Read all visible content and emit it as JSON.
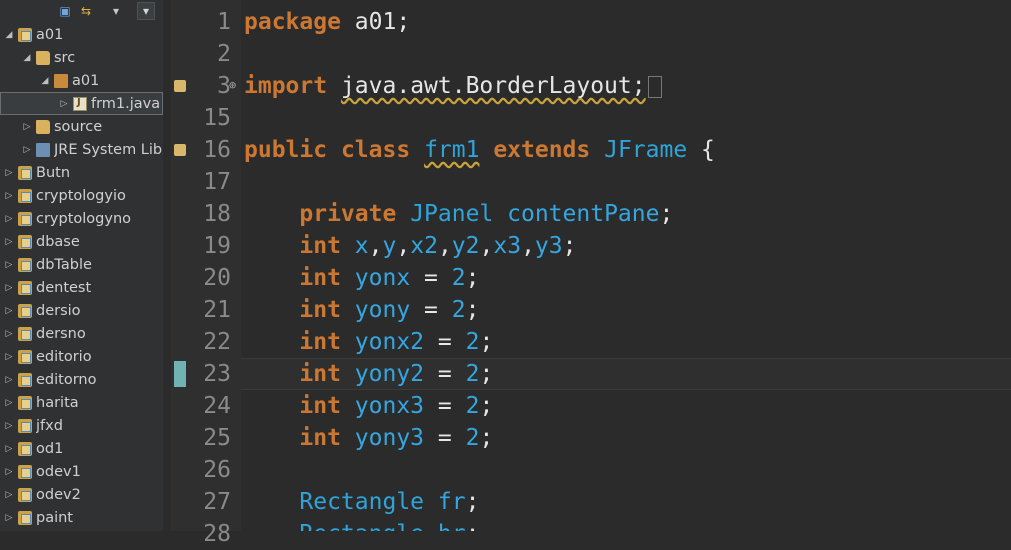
{
  "explorer": {
    "toolbar": {
      "collapse_icon": "collapse-all-icon",
      "link_icon": "link-with-editor-icon",
      "filter_icon": "filter-icon",
      "menu_icon": "view-menu-icon"
    },
    "items": [
      {
        "label": "a01",
        "twisty": "◢",
        "icon": "project",
        "indent": 0
      },
      {
        "label": "src",
        "twisty": "◢",
        "icon": "srcfolder",
        "indent": 1
      },
      {
        "label": "a01",
        "twisty": "◢",
        "icon": "package",
        "indent": 2
      },
      {
        "label": "frm1.java",
        "twisty": "▷",
        "icon": "java",
        "indent": 3,
        "selected": true
      },
      {
        "label": "source",
        "twisty": "▷",
        "icon": "srcfolder",
        "indent": 1
      },
      {
        "label": "JRE System Libr",
        "twisty": "▷",
        "icon": "lib",
        "indent": 1
      },
      {
        "label": "Butn",
        "twisty": "▷",
        "icon": "project",
        "indent": 0
      },
      {
        "label": "cryptologyio",
        "twisty": "▷",
        "icon": "project",
        "indent": 0
      },
      {
        "label": "cryptologyno",
        "twisty": "▷",
        "icon": "project",
        "indent": 0
      },
      {
        "label": "dbase",
        "twisty": "▷",
        "icon": "project",
        "indent": 0
      },
      {
        "label": "dbTable",
        "twisty": "▷",
        "icon": "project",
        "indent": 0
      },
      {
        "label": "dentest",
        "twisty": "▷",
        "icon": "project",
        "indent": 0
      },
      {
        "label": "dersio",
        "twisty": "▷",
        "icon": "project",
        "indent": 0
      },
      {
        "label": "dersno",
        "twisty": "▷",
        "icon": "project",
        "indent": 0
      },
      {
        "label": "editorio",
        "twisty": "▷",
        "icon": "project",
        "indent": 0
      },
      {
        "label": "editorno",
        "twisty": "▷",
        "icon": "project",
        "indent": 0
      },
      {
        "label": "harita",
        "twisty": "▷",
        "icon": "project",
        "indent": 0
      },
      {
        "label": "jfxd",
        "twisty": "▷",
        "icon": "project",
        "indent": 0
      },
      {
        "label": "od1",
        "twisty": "▷",
        "icon": "project",
        "indent": 0
      },
      {
        "label": "odev1",
        "twisty": "▷",
        "icon": "project",
        "indent": 0
      },
      {
        "label": "odev2",
        "twisty": "▷",
        "icon": "project",
        "indent": 0
      },
      {
        "label": "paint",
        "twisty": "▷",
        "icon": "project",
        "indent": 0
      }
    ]
  },
  "editor": {
    "line_numbers": [
      "1",
      "2",
      "3",
      "15",
      "16",
      "17",
      "18",
      "19",
      "20",
      "21",
      "22",
      "23",
      "24",
      "25",
      "26",
      "27",
      "28"
    ],
    "current_line_index": 11,
    "lines": [
      [
        {
          "t": "package",
          "c": "kw"
        },
        {
          "t": " a01;",
          "c": "pl"
        }
      ],
      [],
      [
        {
          "t": "import",
          "c": "kw"
        },
        {
          "t": " ",
          "c": "pl"
        },
        {
          "t": "java.awt.BorderLayout;",
          "c": "pl",
          "u": true
        }
      ],
      [],
      [
        {
          "t": "public",
          "c": "kw"
        },
        {
          "t": " ",
          "c": "pl"
        },
        {
          "t": "class",
          "c": "kw"
        },
        {
          "t": " ",
          "c": "pl"
        },
        {
          "t": "frm1",
          "c": "ty",
          "u": true
        },
        {
          "t": " ",
          "c": "pl"
        },
        {
          "t": "extends",
          "c": "kw"
        },
        {
          "t": " ",
          "c": "pl"
        },
        {
          "t": "JFrame",
          "c": "ty"
        },
        {
          "t": " {",
          "c": "pl"
        }
      ],
      [],
      [
        {
          "t": "    ",
          "c": "pl"
        },
        {
          "t": "private",
          "c": "kw"
        },
        {
          "t": " ",
          "c": "pl"
        },
        {
          "t": "JPanel",
          "c": "ty"
        },
        {
          "t": " ",
          "c": "pl"
        },
        {
          "t": "contentPane",
          "c": "fld"
        },
        {
          "t": ";",
          "c": "pl"
        }
      ],
      [
        {
          "t": "    ",
          "c": "pl"
        },
        {
          "t": "int",
          "c": "kw"
        },
        {
          "t": " ",
          "c": "pl"
        },
        {
          "t": "x",
          "c": "fld"
        },
        {
          "t": ",",
          "c": "pl"
        },
        {
          "t": "y",
          "c": "fld"
        },
        {
          "t": ",",
          "c": "pl"
        },
        {
          "t": "x2",
          "c": "fld"
        },
        {
          "t": ",",
          "c": "pl"
        },
        {
          "t": "y2",
          "c": "fld"
        },
        {
          "t": ",",
          "c": "pl"
        },
        {
          "t": "x3",
          "c": "fld"
        },
        {
          "t": ",",
          "c": "pl"
        },
        {
          "t": "y3",
          "c": "fld"
        },
        {
          "t": ";",
          "c": "pl"
        }
      ],
      [
        {
          "t": "    ",
          "c": "pl"
        },
        {
          "t": "int",
          "c": "kw"
        },
        {
          "t": " ",
          "c": "pl"
        },
        {
          "t": "yonx",
          "c": "fld"
        },
        {
          "t": " = ",
          "c": "pl"
        },
        {
          "t": "2",
          "c": "num"
        },
        {
          "t": ";",
          "c": "pl"
        }
      ],
      [
        {
          "t": "    ",
          "c": "pl"
        },
        {
          "t": "int",
          "c": "kw"
        },
        {
          "t": " ",
          "c": "pl"
        },
        {
          "t": "yony",
          "c": "fld"
        },
        {
          "t": " = ",
          "c": "pl"
        },
        {
          "t": "2",
          "c": "num"
        },
        {
          "t": ";",
          "c": "pl"
        }
      ],
      [
        {
          "t": "    ",
          "c": "pl"
        },
        {
          "t": "int",
          "c": "kw"
        },
        {
          "t": " ",
          "c": "pl"
        },
        {
          "t": "yonx2",
          "c": "fld"
        },
        {
          "t": " = ",
          "c": "pl"
        },
        {
          "t": "2",
          "c": "num"
        },
        {
          "t": ";",
          "c": "pl"
        }
      ],
      [
        {
          "t": "    ",
          "c": "pl"
        },
        {
          "t": "int",
          "c": "kw"
        },
        {
          "t": " ",
          "c": "pl"
        },
        {
          "t": "yony2",
          "c": "fld"
        },
        {
          "t": " = ",
          "c": "pl"
        },
        {
          "t": "2",
          "c": "num"
        },
        {
          "t": ";",
          "c": "pl"
        }
      ],
      [
        {
          "t": "    ",
          "c": "pl"
        },
        {
          "t": "int",
          "c": "kw"
        },
        {
          "t": " ",
          "c": "pl"
        },
        {
          "t": "yonx3",
          "c": "fld"
        },
        {
          "t": " = ",
          "c": "pl"
        },
        {
          "t": "2",
          "c": "num"
        },
        {
          "t": ";",
          "c": "pl"
        }
      ],
      [
        {
          "t": "    ",
          "c": "pl"
        },
        {
          "t": "int",
          "c": "kw"
        },
        {
          "t": " ",
          "c": "pl"
        },
        {
          "t": "yony3",
          "c": "fld"
        },
        {
          "t": " = ",
          "c": "pl"
        },
        {
          "t": "2",
          "c": "num"
        },
        {
          "t": ";",
          "c": "pl"
        }
      ],
      [],
      [
        {
          "t": "    ",
          "c": "pl"
        },
        {
          "t": "Rectangle",
          "c": "ty"
        },
        {
          "t": " ",
          "c": "pl"
        },
        {
          "t": "fr",
          "c": "fld"
        },
        {
          "t": ";",
          "c": "pl"
        }
      ],
      [
        {
          "t": "    ",
          "c": "pl"
        },
        {
          "t": "Rectangle",
          "c": "ty"
        },
        {
          "t": " ",
          "c": "pl"
        },
        {
          "t": "hr",
          "c": "fld"
        },
        {
          "t": ";",
          "c": "pl"
        }
      ]
    ],
    "annotation_icon": "warning-annotation-icon",
    "fold_icon": "fold-expand-icon",
    "annotated_line_indices": [
      2,
      4
    ],
    "fold_line_index": 2
  },
  "colors": {
    "keyword": "#cc7832",
    "type": "#2fa4d9",
    "field": "#35a7e0",
    "plain": "#e6e6e6",
    "background": "#2b2b2b"
  }
}
